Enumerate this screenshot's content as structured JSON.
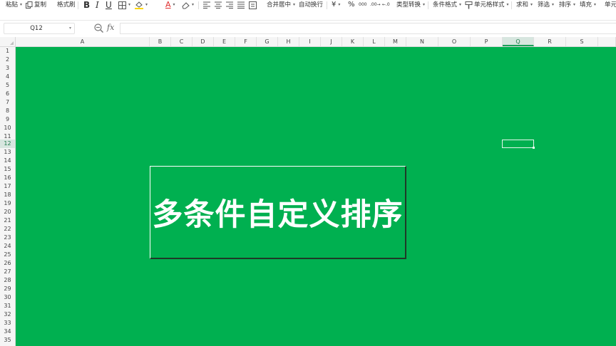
{
  "toolbar": {
    "paste": "粘贴",
    "copy": "复制",
    "format_painter": "格式刷",
    "bold": "B",
    "italic": "I",
    "underline": "U",
    "font_color_glyph": "A",
    "merge_center": "合并居中",
    "wrap_text": "自动换行",
    "currency": "¥",
    "percent": "%",
    "thousands": "000",
    "inc_decimal": ".00→",
    "dec_decimal": "←.0",
    "type_convert": "类型转换",
    "conditional_format": "条件格式",
    "cell_style": "单元格样式",
    "sum": "求和",
    "filter": "筛选",
    "sort": "排序",
    "fill": "填充",
    "cell_partial": "单元",
    "colors": {
      "fill_bar": "#ffd700",
      "font_bar": "#e03030"
    }
  },
  "formula_bar": {
    "name_box": "Q12",
    "fx": "fx",
    "formula": ""
  },
  "grid": {
    "columns": [
      "A",
      "B",
      "C",
      "D",
      "E",
      "F",
      "G",
      "H",
      "I",
      "J",
      "K",
      "L",
      "M",
      "N",
      "O",
      "P",
      "Q",
      "R",
      "S"
    ],
    "active_column": "Q",
    "rows": [
      "1",
      "2",
      "3",
      "4",
      "5",
      "6",
      "7",
      "8",
      "9",
      "10",
      "11",
      "12",
      "13",
      "14",
      "15",
      "16",
      "17",
      "18",
      "19",
      "20",
      "21",
      "22",
      "23",
      "24",
      "25",
      "26",
      "27",
      "28",
      "29",
      "30",
      "31",
      "32",
      "33",
      "34",
      "35"
    ],
    "active_row": "12",
    "fill_color": "#00b050"
  },
  "title_box": {
    "text": "多条件自定义排序",
    "text_color": "#ffffff"
  }
}
